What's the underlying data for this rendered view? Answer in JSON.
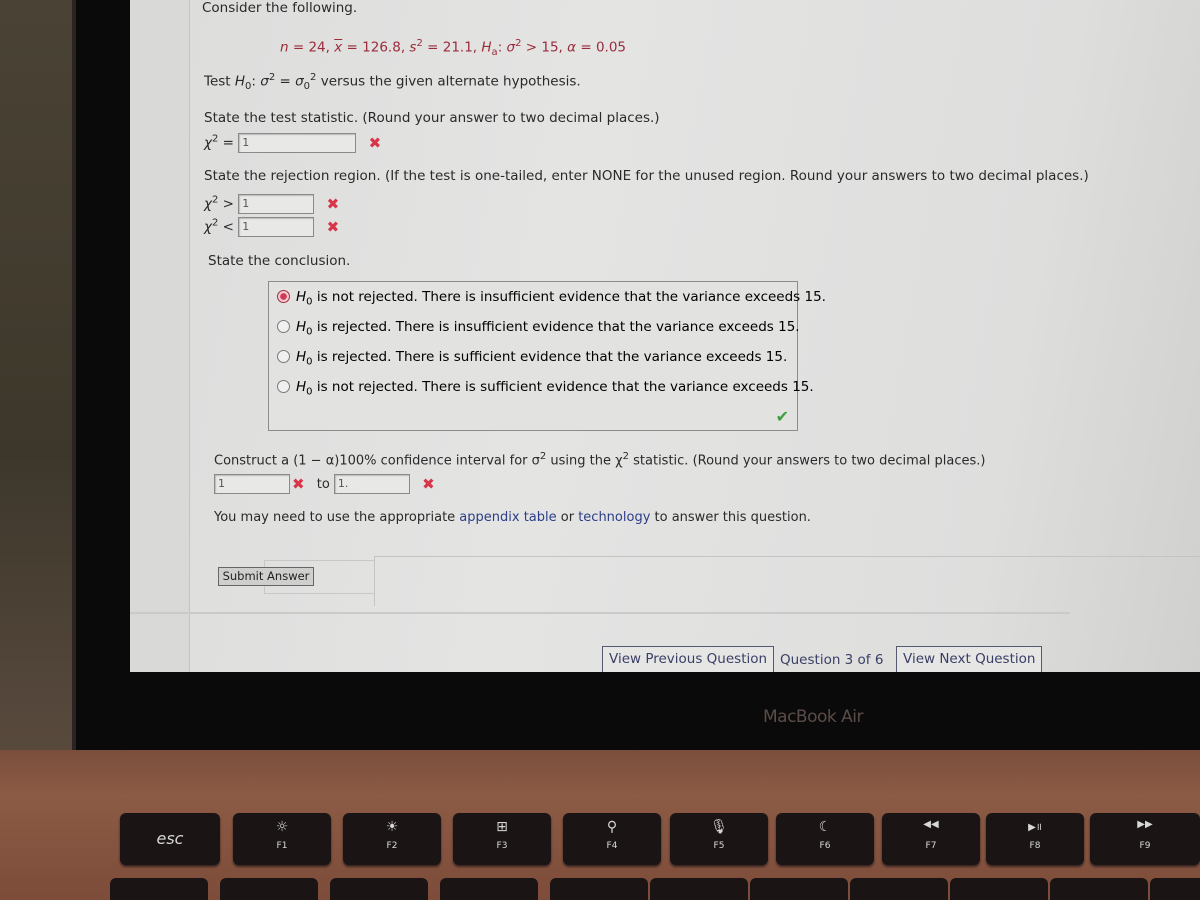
{
  "question": {
    "intro": "Consider the following.",
    "given": {
      "n_label": "n",
      "n_value": "24",
      "xbar_label": "x",
      "xbar_value": "126.8",
      "s2_label": "s",
      "s2_value": "21.1",
      "ha_label": "H",
      "ha_sub": "a",
      "ha_rel": "> 15",
      "alpha_label": "α",
      "alpha_value": "0.05"
    },
    "test_line": "versus the given alternate hypothesis.",
    "test_prefix": "Test",
    "test_statistic_prompt": "State the test statistic. (Round your answer to two decimal places.)",
    "test_statistic_value": "1",
    "rejection_prompt": "State the rejection region. (If the test is one-tailed, enter NONE for the unused region. Round your answers to two decimal places.)",
    "rejection_upper_value": "1",
    "rejection_lower_value": "1",
    "conclusion_prompt": "State the conclusion.",
    "conclusion_options": [
      {
        "text": "is not rejected. There is insufficient evidence that the variance exceeds 15.",
        "selected": true
      },
      {
        "text": "is rejected. There is insufficient evidence that the variance exceeds 15.",
        "selected": false
      },
      {
        "text": "is rejected. There is sufficient evidence that the variance exceeds 15.",
        "selected": false
      },
      {
        "text": "is not rejected. There is sufficient evidence that the variance exceeds 15.",
        "selected": false
      }
    ],
    "ci_prompt_a": "Construct a (1 − α)100% confidence interval for σ",
    "ci_prompt_b": " using the χ",
    "ci_prompt_c": " statistic. (Round your answers to two decimal places.)",
    "ci_lower_value": "1",
    "ci_to": "to",
    "ci_upper_value": "1.",
    "hint_a": "You may need to use the appropriate ",
    "hint_link1": "appendix table",
    "hint_b": " or ",
    "hint_link2": "technology",
    "hint_c": " to answer this question.",
    "submit_label": "Submit Answer",
    "status": {
      "wrong": "✖",
      "correct": "✔"
    }
  },
  "navigation": {
    "prev_label": "View Previous Question",
    "position": "Question 3 of 6",
    "next_label": "View Next Question"
  },
  "device": {
    "brand": "MacBook Air",
    "keys": [
      {
        "label": "esc",
        "icon": ""
      },
      {
        "label": "F1",
        "icon": "☼"
      },
      {
        "label": "F2",
        "icon": "☀"
      },
      {
        "label": "F3",
        "icon": "⊞"
      },
      {
        "label": "F4",
        "icon": "⚲"
      },
      {
        "label": "F5",
        "icon": "🎙"
      },
      {
        "label": "F6",
        "icon": "☾"
      },
      {
        "label": "F7",
        "icon": "◀◀"
      },
      {
        "label": "F8",
        "icon": "▶॥"
      },
      {
        "label": "F9",
        "icon": "▶▶"
      }
    ]
  }
}
